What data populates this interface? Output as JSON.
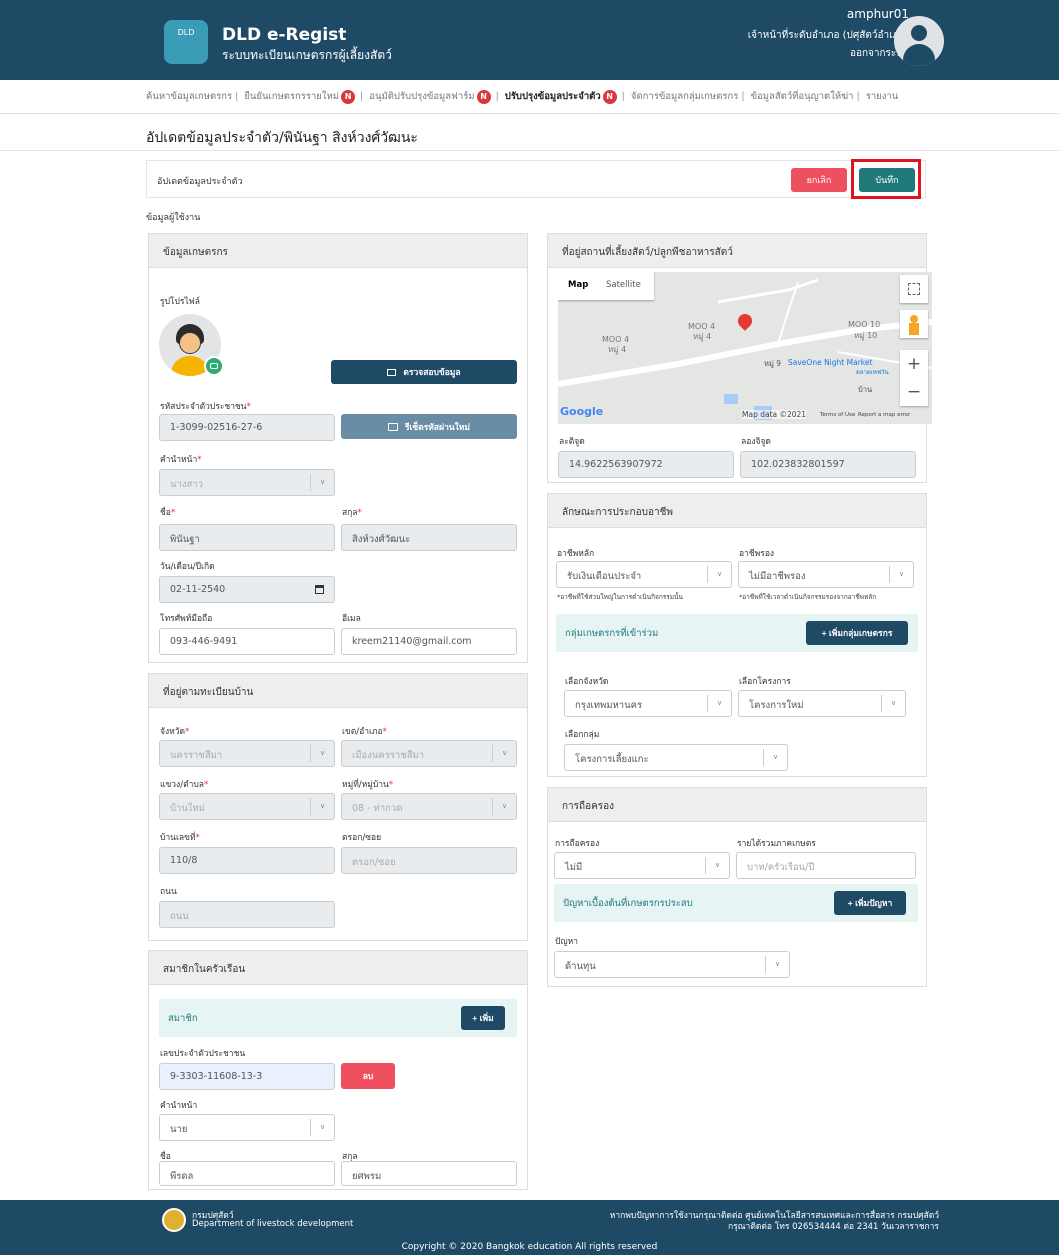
{
  "header": {
    "app_title": "DLD e-Regist",
    "app_subtitle": "ระบบทะเบียนเกษตรกรผู้เลี้ยงสัตว์",
    "logo_text": "DLD",
    "user_name": "amphur01",
    "user_role": "เจ้าหน้าที่ระดับอำเภอ (ปศุสัตว์อำเภอ)",
    "logout": "ออกจากระบบ"
  },
  "nav": {
    "items": [
      {
        "label": "ค้นหาข้อมูลเกษตรกร",
        "badge": ""
      },
      {
        "label": "ยืนยันเกษตรกรรายใหม่",
        "badge": "N"
      },
      {
        "label": "อนุมัติปรับปรุงข้อมูลฟาร์ม",
        "badge": "N"
      },
      {
        "label": "ปรับปรุงข้อมูลประจำตัว",
        "badge": "N",
        "active": true
      },
      {
        "label": "จัดการข้อมูลกลุ่มเกษตรกร",
        "badge": ""
      },
      {
        "label": "ข้อมูลสัตว์ที่อนุญาตให้ฆ่า",
        "badge": ""
      },
      {
        "label": "รายงาน",
        "badge": ""
      }
    ]
  },
  "page": {
    "title": "อัปเดตข้อมูลประจำตัว/พินันฐา สิงห์วงศ์วัฒนะ",
    "bar_label": "อัปเดตข้อมูลประจำตัว",
    "cancel": "ยกเลิก",
    "save": "บันทึก",
    "section_label": "ข้อมูลผู้ใช้งาน"
  },
  "farmer": {
    "header": "ข้อมูลเกษตรกร",
    "profile_label": "รูปโปรไฟล์",
    "verify_btn": "ตรวจสอบข้อมูล",
    "id_label": "รหัสประจำตัวประชาชน",
    "id_value": "1-3099-02516-27-6",
    "reset_btn": "รีเซ็ตรหัสผ่านใหม่",
    "prefix_label": "คำนำหน้า",
    "prefix_value": "นางสาว",
    "first_label": "ชื่อ",
    "first_value": "พินันฐา",
    "last_label": "สกุล",
    "last_value": "สิงห์วงศ์วัฒนะ",
    "dob_label": "วัน/เดือน/ปีเกิด",
    "dob_value": "02-11-2540",
    "phone_label": "โทรศัพท์มือถือ",
    "phone_value": "093-446-9491",
    "email_label": "อีเมล",
    "email_value": "kreem21140@gmail.com"
  },
  "address": {
    "header": "ที่อยู่ตามทะเบียนบ้าน",
    "province_label": "จังหวัด",
    "province_value": "นครราชสีมา",
    "district_label": "เขต/อำเภอ",
    "district_value": "เมืองนครราชสีมา",
    "subdistrict_label": "แขวง/ตำบล",
    "subdistrict_value": "บ้านใหม่",
    "village_label": "หมู่ที่/หมู่บ้าน",
    "village_value": "08 - ท่ากวด",
    "house_label": "บ้านเลขที่",
    "house_value": "110/8",
    "alley_label": "ตรอก/ซอย",
    "alley_placeholder": "ตรอก/ซอย",
    "road_label": "ถนน",
    "road_placeholder": "ถนน"
  },
  "members": {
    "header": "สมาชิกในครัวเรือน",
    "bar": "สมาชิก",
    "add_btn": "+ เพิ่ม",
    "id_label": "เลขประจำตัวประชาชน",
    "id_value": "9-3303-11608-13-3",
    "delete_btn": "ลบ",
    "prefix_label": "คำนำหน้า",
    "prefix_value": "นาย",
    "first_label": "ชื่อ",
    "first_value": "พีรดล",
    "last_label": "สกุล",
    "last_value": "ยศพรม"
  },
  "location": {
    "header": "ที่อยู่สถานที่เลี้ยงสัตว์/ปลูกพืชอาหารสัตว์",
    "map": {
      "tab_map": "Map",
      "tab_satellite": "Satellite",
      "labels": [
        "MOO 4",
        "หมู่ 4",
        "MOO 4",
        "หมู่ 4",
        "MOO 10",
        "หมู่ 10",
        "หมู่ 9",
        "SaveOne Night Market",
        "ตลาดเซฟวัน",
        "บ้าน"
      ],
      "google": "Google",
      "attribution": "Map data ©2021",
      "terms": "Terms of Use",
      "report": "Report a map error",
      "zoom_in": "+",
      "zoom_out": "−"
    },
    "lat_label": "ละติจูด",
    "lat_value": "14.9622563907972",
    "lng_label": "ลองจิจูด",
    "lng_value": "102.023832801597"
  },
  "occupation": {
    "header": "ลักษณะการประกอบอาชีพ",
    "main_label": "อาชีพหลัก",
    "main_value": "รับเงินเดือนประจำ",
    "main_hint": "*อาชีพที่ใช้ส่วนใหญ่ในการดำเนินกิจกรรมนั้น",
    "side_label": "อาชีพรอง",
    "side_value": "ไม่มีอาชีพรอง",
    "side_hint": "*อาชีพที่ใช้เวลาดำเนินกิจกรรมรองจากอาชีพหลัก",
    "group_bar": "กลุ่มเกษตรกรที่เข้าร่วม",
    "group_btn": "+ เพิ่มกลุ่มเกษตรกร",
    "prov_label": "เลือกจังหวัด",
    "prov_value": "กรุงเทพมหานคร",
    "proj_label": "เลือกโครงการ",
    "proj_value": "โครงการใหม่",
    "grp_label": "เลือกกลุ่ม",
    "grp_value": "โครงการเลี้ยงแกะ"
  },
  "holding": {
    "header": "การถือครอง",
    "hold_label": "การถือครอง",
    "hold_value": "ไม่มี",
    "income_label": "รายได้รวมภาคเกษตร",
    "income_placeholder": "บาท/ครัวเรือน/ปี",
    "problem_bar": "ปัญหาเบื้องต้นที่เกษตรกรประสบ",
    "problem_btn": "+ เพิ่มปัญหา",
    "problem_label": "ปัญหา",
    "problem_value": "ด้านทุน"
  },
  "footer": {
    "org_th": "กรมปศุสัตว์",
    "org_en": "Department of livestock development",
    "contact1": "หากพบปัญหาการใช้งานกรุณาติดต่อ ศูนย์เทคโนโลยีสารสนเทศและการสื่อสาร กรมปศุสัตว์",
    "contact2": "กรุณาติดต่อ โทร 026534444 ต่อ 2341 วันเวลาราชการ",
    "copyright": "Copyright © 2020 Bangkok education All rights reserved"
  }
}
